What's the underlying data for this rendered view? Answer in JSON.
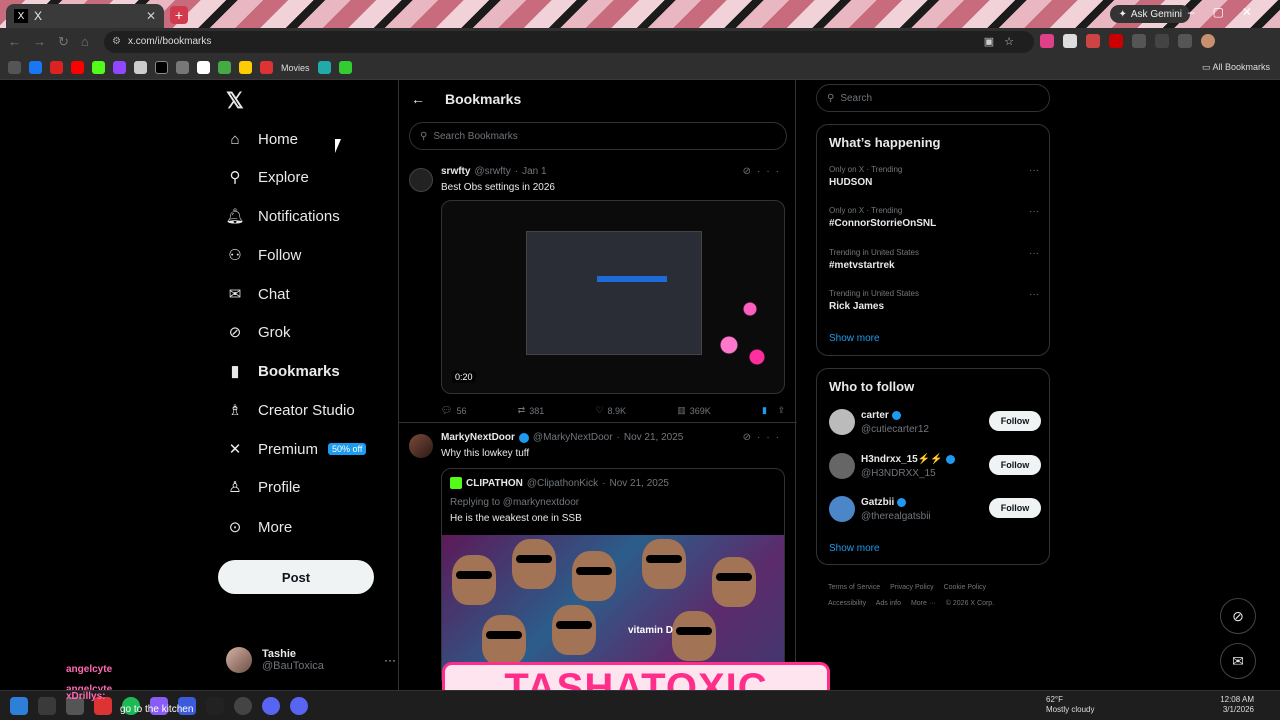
{
  "browser": {
    "tab_title": "X",
    "gemini_label": "Ask Gemini",
    "url": "x.com/i/bookmarks",
    "bookmark_movies": "Movies",
    "all_bookmarks": "All Bookmarks"
  },
  "nav": {
    "items": [
      {
        "label": "Home",
        "icon": "home-icon"
      },
      {
        "label": "Explore",
        "icon": "search-icon"
      },
      {
        "label": "Notifications",
        "icon": "bell-icon"
      },
      {
        "label": "Follow",
        "icon": "follow-icon"
      },
      {
        "label": "Chat",
        "icon": "mail-icon"
      },
      {
        "label": "Grok",
        "icon": "grok-icon"
      },
      {
        "label": "Bookmarks",
        "icon": "bookmark-icon"
      },
      {
        "label": "Creator Studio",
        "icon": "creator-icon"
      },
      {
        "label": "Premium",
        "icon": "x-icon"
      },
      {
        "label": "Profile",
        "icon": "profile-icon"
      },
      {
        "label": "More",
        "icon": "more-icon"
      }
    ],
    "premium_badge": "50% off",
    "post_label": "Post",
    "account_name": "Tashie",
    "account_handle": "@BauToxica"
  },
  "main": {
    "title": "Bookmarks",
    "search_placeholder": "Search Bookmarks",
    "tweets": [
      {
        "name": "srwfty",
        "handle": "@srwfty",
        "date": "Jan 1",
        "text": "Best Obs settings in 2026",
        "duration": "0:20",
        "replies": "56",
        "reposts": "381",
        "likes": "8.9K",
        "views": "369K"
      },
      {
        "name": "MarkyNextDoor",
        "handle": "@MarkyNextDoor",
        "date": "Nov 21, 2025",
        "text": "Why this lowkey tuff",
        "quote_name": "CLIPATHON",
        "quote_handle": "@ClipathonKick",
        "quote_date": "Nov 21, 2025",
        "quote_reply": "Replying to @markynextdoor",
        "quote_text": "He is the weakest one in SSB",
        "quote_overlay": "vitamin D"
      }
    ]
  },
  "right": {
    "search_placeholder": "Search",
    "happening_title": "What’s happening",
    "trends": [
      {
        "context": "Only on X · Trending",
        "title": "HUDSON"
      },
      {
        "context": "Only on X · Trending",
        "title": "#ConnorStorrieOnSNL"
      },
      {
        "context": "Trending in United States",
        "title": "#metvstartrek"
      },
      {
        "context": "Trending in United States",
        "title": "Rick James"
      }
    ],
    "show_more": "Show more",
    "who_title": "Who to follow",
    "follow_label": "Follow",
    "who": [
      {
        "name": "carter",
        "handle": "@cutiecarter12"
      },
      {
        "name": "H3ndrxx_15⚡⚡",
        "handle": "@H3NDRXX_15"
      },
      {
        "name": "Gatzbii",
        "handle": "@therealgatsbii"
      }
    ],
    "footer": [
      "Terms of Service",
      "Privacy Policy",
      "Cookie Policy",
      "Accessibility",
      "Ads info",
      "More ···",
      "© 2026 X Corp."
    ]
  },
  "overlay": {
    "chat_user1": "angelcyte",
    "chat_user2": "angelcyte",
    "chat_user3": "xDrillys:",
    "chat_message": "go to the kitchen",
    "banner": "TASHATOXIC"
  },
  "taskbar": {
    "weather_temp": "62°F",
    "weather_desc": "Mostly cloudy",
    "time": "12:08 AM",
    "date": "3/1/2026"
  },
  "colors": {
    "accent": "#1d9bf0",
    "background": "#000000",
    "banner_pink": "#ff2e8a"
  }
}
